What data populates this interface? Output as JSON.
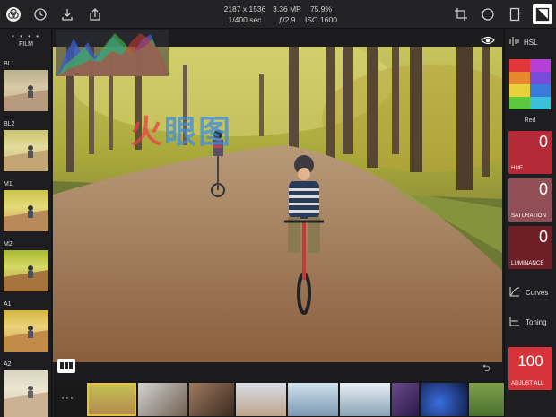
{
  "meta": {
    "dimensions": "2187 x 1536",
    "megapixels": "3.36 MP",
    "zoom": "75.9%",
    "shutter": "1/400 sec",
    "aperture": "ƒ/2.9",
    "iso": "ISO 1600"
  },
  "left": {
    "film_label": "FILM",
    "presets": [
      "BL1",
      "BL2",
      "M1",
      "M2",
      "A1",
      "A2"
    ]
  },
  "right": {
    "hsl_label": "HSL",
    "selected_color": "Red",
    "hue": {
      "value": "0",
      "label": "HUE"
    },
    "saturation": {
      "value": "0",
      "label": "SATURATION"
    },
    "luminance": {
      "value": "0",
      "label": "LUMINANCE"
    },
    "curves_label": "Curves",
    "toning_label": "Toning",
    "adjust_all": {
      "value": "100",
      "label": "ADJUST ALL"
    }
  },
  "more_label": "···",
  "watermark": "火眼图",
  "colors": {
    "accent_red": "#d7343a",
    "panel_bg": "#1e1e20"
  }
}
